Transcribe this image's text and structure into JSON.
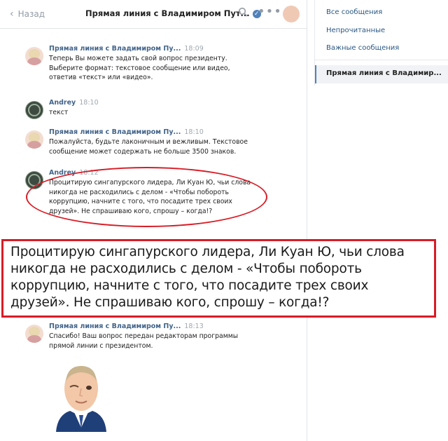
{
  "header": {
    "back_label": "Назад",
    "title": "Прямая линия с Владимиром Пут...",
    "verified_icon": "check-icon",
    "search_icon": "search-icon",
    "more_icon": "more-icon"
  },
  "messages": [
    {
      "author": "Прямая линия с Владимиром Пу...",
      "time": "18:09",
      "text": "Теперь Вы можете задать свой вопрос президенту. Выберите формат: текстовое сообщение или видео, ответив «текст» или «видео»."
    },
    {
      "author": "Andrey",
      "time": "18:10",
      "text": "текст"
    },
    {
      "author": "Прямая линия с Владимиром Пу...",
      "time": "18:10",
      "text": "Пожалуйста, будьте лаконичным и вежливым. Текстовое сообщение может содержать не больше 3500 знаков."
    },
    {
      "author": "Andrey",
      "time": "18:12",
      "text": "Процитирую сингапурского лидера, Ли Куан Ю, чьи слова никогда не расходились с делом - «Чтобы побороть коррупцию, начните с того, что посадите трех своих друзей». Не спрашиваю кого, спрошу – когда!?"
    },
    {
      "author": "Прямая линия с Владимиром Пу...",
      "time": "18:13",
      "text": "Спасибо! Ваш вопрос передан редакторам программы прямой линии с президентом."
    }
  ],
  "callout": {
    "text": "Процитирую сингапурского лидера, Ли Куан Ю, чьи слова никогда не расходились с делом - «Чтобы побороть коррупцию, начните с того, что посадите трех своих друзей». Не спрашиваю кого, спрошу – когда!?"
  },
  "menu": {
    "items": [
      "Все сообщения",
      "Непрочитанные",
      "Важные сообщения"
    ],
    "active": "Прямая линия с Владимир..."
  },
  "colors": {
    "accent": "#5181b8",
    "link": "#2a5885",
    "highlight": "#d81c26"
  }
}
